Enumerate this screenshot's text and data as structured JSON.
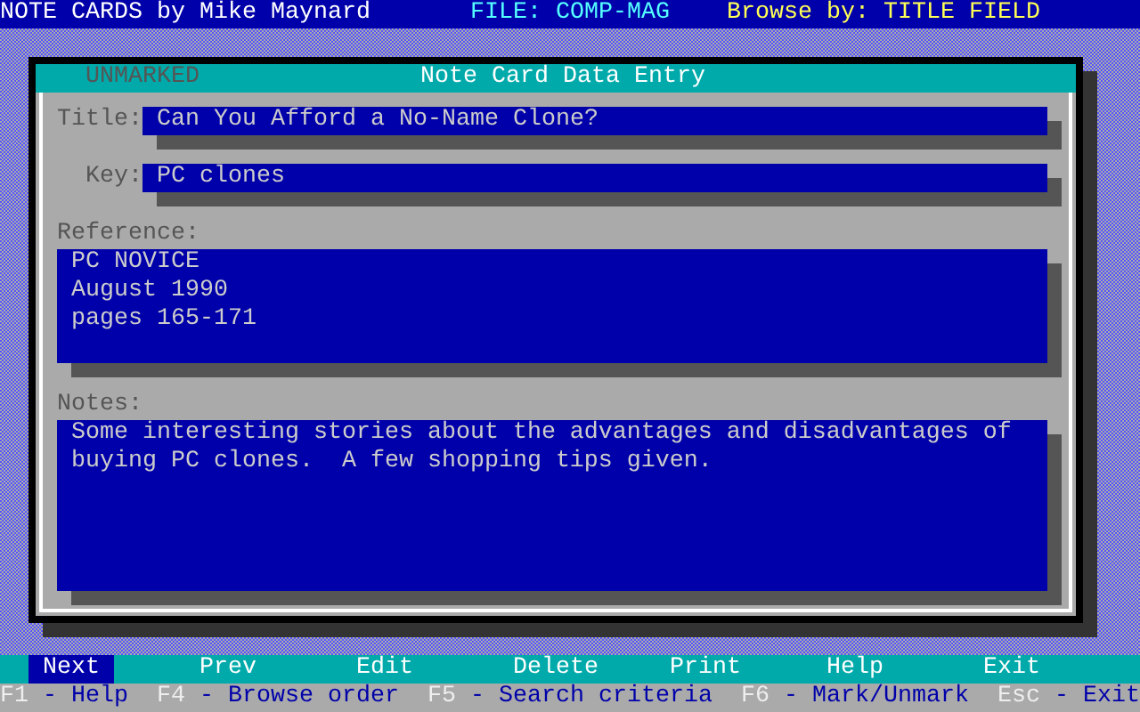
{
  "top_bar": {
    "app_title": "NOTE CARDS by Mike Maynard",
    "file": "FILE: COMP-MAG",
    "browse": "Browse by: TITLE FIELD"
  },
  "dialog": {
    "status": "UNMARKED",
    "title": "Note Card Data Entry",
    "fields": [
      {
        "kind": "line",
        "label": "Title:",
        "value": "Can You Afford a No-Name Clone?"
      },
      {
        "kind": "line",
        "label": "Key:",
        "value": "PC clones"
      },
      {
        "kind": "block",
        "label": "Reference:",
        "lines": [
          "PC NOVICE",
          "August 1990",
          "pages 165-171"
        ]
      },
      {
        "kind": "block",
        "label": "Notes:",
        "lines": [
          "Some interesting stories about the advantages and disadvantages of",
          "buying PC clones.  A few shopping tips given."
        ]
      }
    ]
  },
  "menu": [
    {
      "label": "Next",
      "selected": true
    },
    {
      "label": "Prev",
      "selected": false
    },
    {
      "label": "Edit",
      "selected": false
    },
    {
      "label": "Delete",
      "selected": false
    },
    {
      "label": "Print",
      "selected": false
    },
    {
      "label": "Help",
      "selected": false
    },
    {
      "label": "Exit",
      "selected": false
    }
  ],
  "shortcuts": [
    {
      "key": "F1",
      "label": "- Help"
    },
    {
      "key": "F4",
      "label": "- Browse order"
    },
    {
      "key": "F5",
      "label": "- Search criteria"
    },
    {
      "key": "F6",
      "label": "- Mark/Unmark"
    },
    {
      "key": "Esc",
      "label": "- Exit"
    }
  ]
}
